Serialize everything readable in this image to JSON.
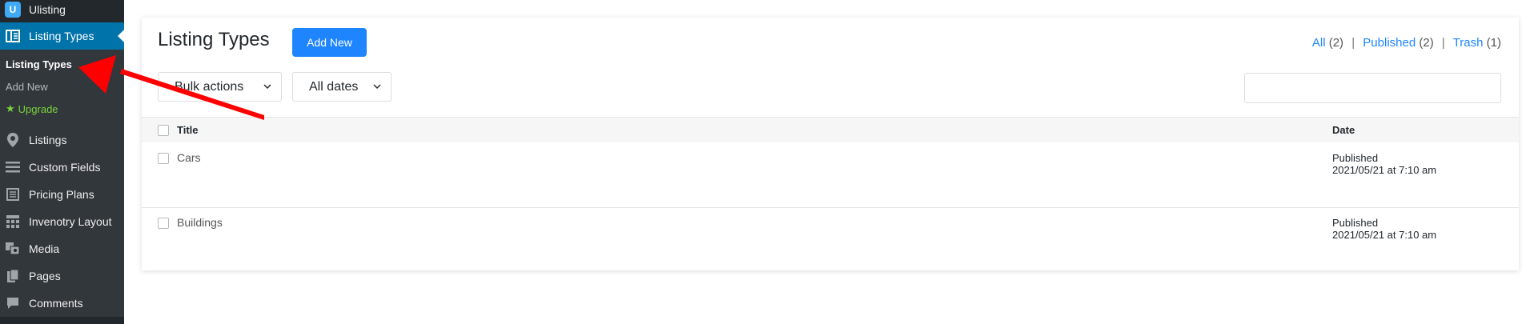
{
  "sidebar": {
    "app_name": "Ulisting",
    "active_label": "Listing Types",
    "sub_items": [
      "Listing Types",
      "Add New",
      "Upgrade"
    ],
    "items": [
      "Listings",
      "Custom Fields",
      "Pricing Plans",
      "Invenotry Layout",
      "Media",
      "Pages",
      "Comments"
    ]
  },
  "header": {
    "title": "Listing Types",
    "add_new_label": "Add New",
    "views": {
      "all_label": "All",
      "all_count": "(2)",
      "published_label": "Published",
      "published_count": "(2)",
      "trash_label": "Trash",
      "trash_count": "(1)",
      "separator": "|"
    }
  },
  "filters": {
    "bulk_actions": "Bulk actions",
    "dates": "All dates",
    "search_value": ""
  },
  "table": {
    "columns": [
      "Title",
      "Date"
    ],
    "rows": [
      {
        "title": "Cars",
        "status": "Published",
        "date": "2021/05/21 at 7:10 am"
      },
      {
        "title": "Buildings",
        "status": "Published",
        "date": "2021/05/21 at 7:10 am"
      }
    ]
  },
  "colors": {
    "sidebar_bg": "#23282d",
    "active": "#0073aa",
    "accent_button": "#1e85ff",
    "arrow": "#ff0000"
  }
}
